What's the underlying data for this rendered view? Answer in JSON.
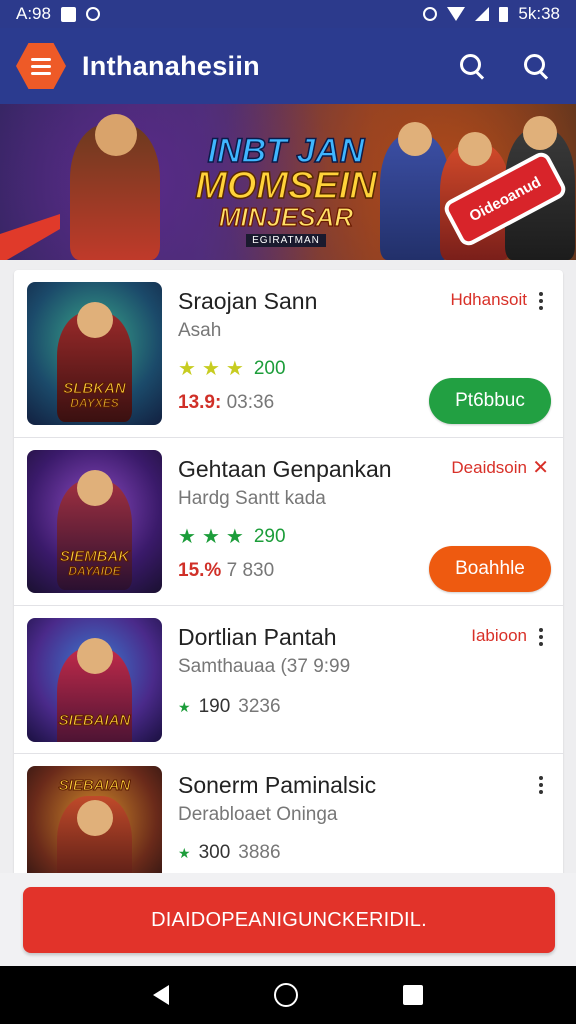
{
  "status_bar": {
    "time": "A:98",
    "clock": "5k:38"
  },
  "app_bar": {
    "title": "Inthanahesiin"
  },
  "banner": {
    "line1": "INBT JAN",
    "line2": "MOMSEIN",
    "line3": "MINJESAR",
    "subtitle": "EGIRATMAN",
    "promo": "Oideoanud"
  },
  "items": [
    {
      "name": "Sraojan Sann",
      "sub": "Asah",
      "tag": "Hdhansoit",
      "rating": "200",
      "meta_red": "13.9:",
      "meta": "03:36",
      "button": "Pt6bbuc",
      "button_color": "#22a042",
      "thumb_text": "SLBKAN",
      "thumb_text2": "DAYXES"
    },
    {
      "name": "Gehtaan Genpankan",
      "sub": "Hardg Santt kada",
      "tag": "Deaidsoin",
      "rating": "290",
      "meta_red": "15.%",
      "meta": "7 830",
      "button": "Boahhle",
      "button_color": "#ee5a10",
      "thumb_text": "SIEMBAK",
      "thumb_text2": "DAYAIDE"
    },
    {
      "name": "Dortlian Pantah",
      "sub": "Samthauaa (37 9:99",
      "tag": "Iabioon",
      "rating": "190",
      "meta": "3236",
      "thumb_text": "SIEBAIAN",
      "thumb_text2": ""
    },
    {
      "name": "Sonerm Paminalsic",
      "sub": "Derabloaet Oninga",
      "rating": "300",
      "meta": "3886",
      "thumb_text": "SIEBAIAN",
      "thumb_text2": ""
    }
  ],
  "cta": {
    "label": "DIAIDOPEANIGUNCKERIDIL."
  }
}
